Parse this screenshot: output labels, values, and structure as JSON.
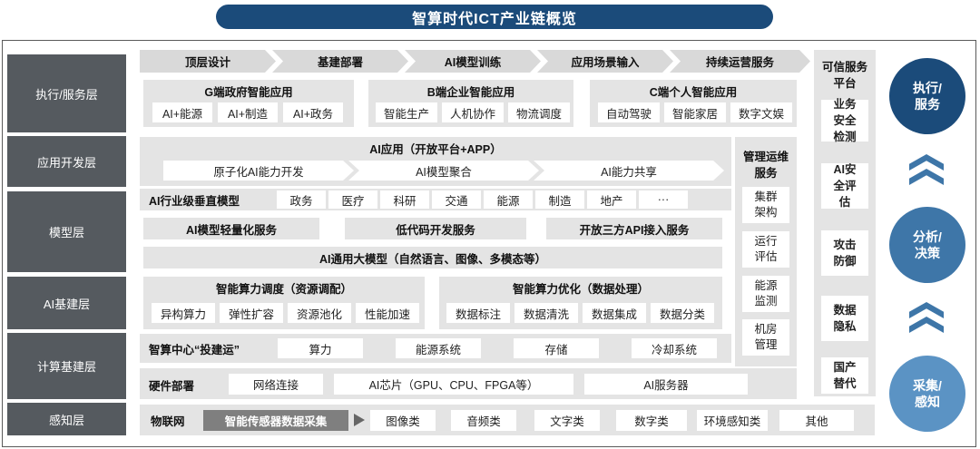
{
  "title": "智算时代ICT产业链概览",
  "layers": [
    "执行/服务层",
    "应用开发层",
    "模型层",
    "AI基建层",
    "计算基建层",
    "感知层"
  ],
  "execution": {
    "steps": [
      "顶层设计",
      "基建部署",
      "AI模型训练",
      "应用场景输入",
      "持续运营服务"
    ],
    "g": {
      "title": "G端政府智能应用",
      "items": [
        "AI+能源",
        "AI+制造",
        "AI+政务"
      ]
    },
    "b": {
      "title": "B端企业智能应用",
      "items": [
        "智能生产",
        "人机协作",
        "物流调度"
      ]
    },
    "c": {
      "title": "C端个人智能应用",
      "items": [
        "自动驾驶",
        "智能家居",
        "数字文娱"
      ]
    }
  },
  "appdev": {
    "title": "AI应用（开放平台+APP）",
    "steps": [
      "原子化AI能力开发",
      "AI模型聚合",
      "AI能力共享"
    ]
  },
  "model": {
    "vertical_title": "AI行业级垂直模型",
    "vertical_items": [
      "政务",
      "医疗",
      "科研",
      "交通",
      "能源",
      "制造",
      "地产",
      "···"
    ],
    "services": [
      "AI模型轻量化服务",
      "低代码开发服务",
      "开放三方API接入服务"
    ],
    "general": "AI通用大模型（自然语言、图像、多模态等）"
  },
  "aiinfra": {
    "left": {
      "title": "智能算力调度（资源调配）",
      "items": [
        "异构算力",
        "弹性扩容",
        "资源池化",
        "性能加速"
      ]
    },
    "right": {
      "title": "智能算力优化（数据处理）",
      "items": [
        "数据标注",
        "数据清洗",
        "数据集成",
        "数据分类"
      ]
    }
  },
  "compute": {
    "center_title": "智算中心“投建运”",
    "center_items": [
      "算力",
      "能源系统",
      "存储",
      "冷却系统"
    ],
    "hw_title": "硬件部署",
    "hw_items": [
      "网络连接",
      "AI芯片（GPU、CPU、FPGA等）",
      "AI服务器"
    ]
  },
  "sense": {
    "title": "物联网",
    "highlight": "智能传感器数据采集",
    "items": [
      "图像类",
      "音频类",
      "文字类",
      "数字类",
      "环境感知类",
      "其他"
    ]
  },
  "ops": {
    "title": "管理运维服务",
    "items": [
      "集群架构",
      "运行评估",
      "能源监测",
      "机房管理"
    ]
  },
  "trust": {
    "title": "可信服务平台",
    "items": [
      "业务安全检测",
      "AI安全评估",
      "攻击防御",
      "数据隐私",
      "国产替代"
    ]
  },
  "circles": [
    "执行/服务",
    "分析/决策",
    "采集/感知"
  ],
  "colors": {
    "title_bg": "#1b4b7a",
    "layer_bg": "#555a5f",
    "circle1": "#1b4b7a",
    "circle2": "#3e76a8",
    "circle3": "#5b93c4"
  }
}
